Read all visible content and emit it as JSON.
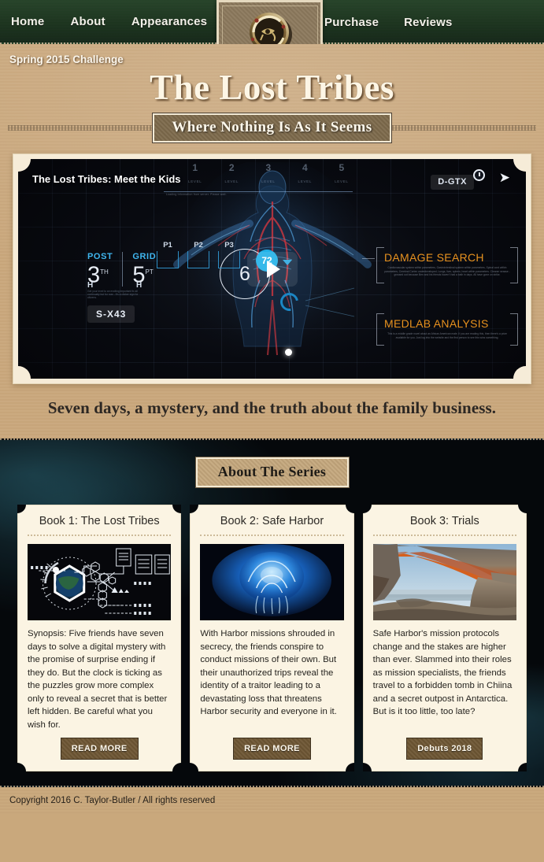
{
  "nav": {
    "left_items": [
      {
        "label": "Home",
        "name": "nav-item-home"
      },
      {
        "label": "About",
        "name": "nav-item-about"
      },
      {
        "label": "Appearances",
        "name": "nav-item-appearances"
      }
    ],
    "right_items": [
      {
        "label": "Purchase",
        "name": "nav-item-purchase"
      },
      {
        "label": "Reviews",
        "name": "nav-item-reviews"
      }
    ],
    "emblem_icon": "eye-of-horus-amulet-icon",
    "bar_color": "#1d351f"
  },
  "hero": {
    "challenge_label": "Spring 2015 Challenge",
    "site_title": "The Lost Tribes",
    "tagline_box": "Where Nothing Is As It Seems",
    "bottom_tagline": "Seven days, a mystery, and the truth about the family business.",
    "background_color": "#caa87d"
  },
  "video": {
    "title": "The Lost Tribes: Meet the Kids",
    "loading_text": "Loading information from server. Please wait.",
    "quality_badge": "D-GTX",
    "clock_icon": "clock-icon",
    "share_icon": "share-icon",
    "play_icon": "play-icon",
    "levels": [
      {
        "number": "1",
        "label": "LEVEL"
      },
      {
        "number": "2",
        "label": "LEVEL"
      },
      {
        "number": "3",
        "label": "LEVEL"
      },
      {
        "number": "4",
        "label": "LEVEL"
      },
      {
        "number": "5",
        "label": "LEVEL"
      }
    ],
    "hud": {
      "post_label": "POST",
      "post_value": "3",
      "post_suffix": "TH",
      "grid_label": "GRID",
      "grid_value": "5",
      "grid_suffix": "PT",
      "micro_text": "Get your level to an exciting important fix all continually but for now - it's a clicker sign for citizens.",
      "chip_label": "S-X43",
      "dial_value": "6",
      "badge_value": "72",
      "ports": [
        "P1",
        "P2",
        "P3"
      ],
      "h_left": "H",
      "h_right": "H"
    },
    "panels": [
      {
        "title": "DAMAGE SEARCH",
        "body": "Cardiovascular system within parameters, Gastrointestinal system within parameters, Spinal cord within parameters, Cerebral Cortex underdeveloped, Lungs, liver, spleen, heart within parameters. Cleaner wrasse - grossed out because Ben and his friends haven't had a bath in days. All have gone on strike."
      },
      {
        "title": "MEDLAB ANALYSIS",
        "body": "This is a middle grade novel about an African American male. If you are reading this, then there's a prize available for you. Just log into the website and the first person to see this wins something."
      }
    ],
    "accent_cyan": "#3fb6ef",
    "accent_orange": "#e8921f"
  },
  "series": {
    "section_title": "About The Series",
    "books": [
      {
        "title": "Book 1: The Lost Tribes",
        "image_name": "hex-planet-tech-cover-image",
        "synopsis": "Synopsis: Five friends have seven days to solve a digital mystery with the promise of surprise ending if they do. But the clock is ticking as the puzzles grow more complex only to reveal a secret that is better left hidden. Be careful what you wish for.",
        "button_label": "READ MORE"
      },
      {
        "title": "Book 2: Safe Harbor",
        "image_name": "blue-jellyfish-cover-image",
        "synopsis": "With Harbor missions shrouded in secrecy, the friends conspire to conduct missions of their own. But their unauthorized trips reveal the identity of a traitor leading to a devastating loss that threatens Harbor security and everyone in it.",
        "button_label": "READ MORE"
      },
      {
        "title": "Book 3: Trials",
        "image_name": "mesa-arch-canyon-cover-image",
        "synopsis": "Safe Harbor's mission protocols change and the stakes are higher than ever. Slammed into their roles as mission specialists, the friends travel to a forbidden tomb in Chiina and a secret outpost in Antarctica. But is it too little, too late?",
        "button_label": "Debuts 2018"
      }
    ]
  },
  "footer": {
    "copyright": "Copyright 2016 C. Taylor-Butler / All rights reserved"
  }
}
